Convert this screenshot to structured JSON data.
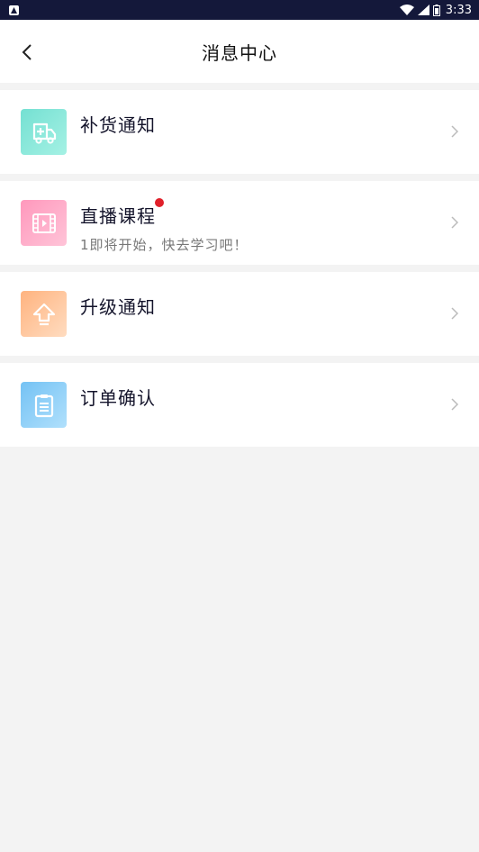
{
  "statusbar": {
    "time": "3:33",
    "notification_icon": "a-notification-icon",
    "icons": [
      "wifi-icon",
      "signal-icon",
      "battery-icon"
    ]
  },
  "header": {
    "title": "消息中心",
    "back_icon": "chevron-left-icon"
  },
  "items": [
    {
      "title": "补货通知",
      "subtitle": "",
      "icon": "delivery-truck-icon",
      "color_from": "#7ee6d6",
      "color_to": "#9ef0e2",
      "unread": false
    },
    {
      "title": "直播课程",
      "subtitle": "1即将开始，快去学习吧！",
      "icon": "video-film-icon",
      "color_from": "#ff9ec0",
      "color_to": "#ffc0d6",
      "unread": true
    },
    {
      "title": "升级通知",
      "subtitle": "",
      "icon": "upgrade-arrow-icon",
      "color_from": "#ffb98a",
      "color_to": "#ffd6b5",
      "unread": false
    },
    {
      "title": "订单确认",
      "subtitle": "",
      "icon": "clipboard-icon",
      "color_from": "#7cc6f5",
      "color_to": "#a9dcfb",
      "unread": false
    }
  ],
  "colors": {
    "unread_dot": "#e0202a",
    "statusbar_bg": "#14183a"
  }
}
